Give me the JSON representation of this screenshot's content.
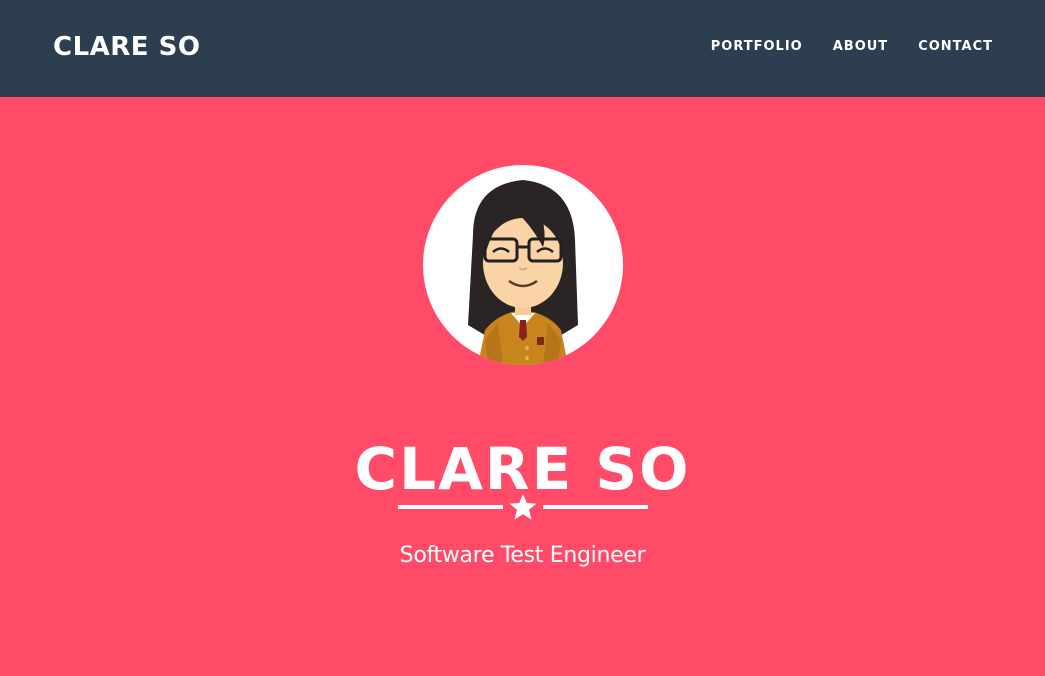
{
  "navbar": {
    "brand": "CLARE SO",
    "links": [
      {
        "label": "PORTFOLIO"
      },
      {
        "label": "ABOUT"
      },
      {
        "label": "CONTACT"
      }
    ]
  },
  "hero": {
    "title": "CLARE SO",
    "subtitle": "Software Test Engineer",
    "divider_icon": "star-icon",
    "avatar_icon": "avatar-portrait"
  },
  "colors": {
    "navbar_bg": "#2c3e50",
    "hero_bg": "#ff4b68",
    "text": "#ffffff"
  }
}
